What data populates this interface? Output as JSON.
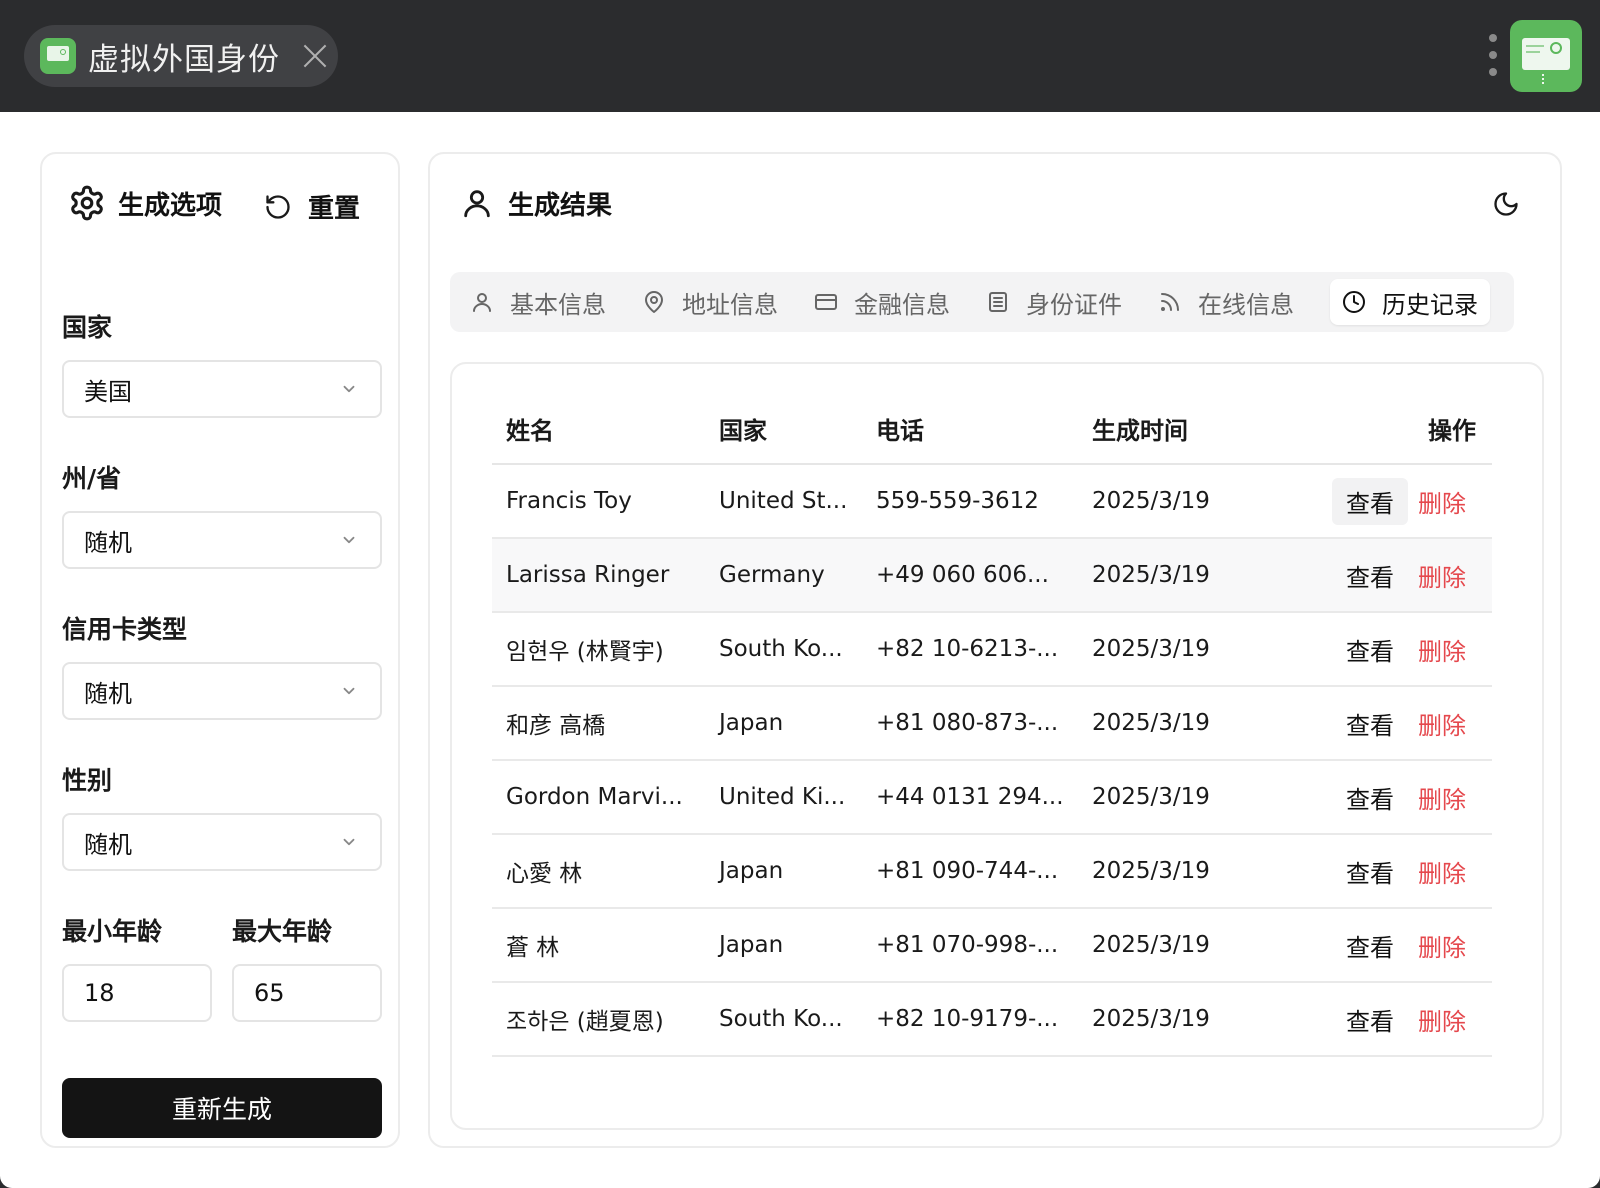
{
  "window": {
    "tab_title": "虚拟外国身份"
  },
  "left": {
    "title": "生成选项",
    "reset_label": "重置",
    "country_label": "国家",
    "country_value": "美国",
    "state_label": "州/省",
    "state_value": "随机",
    "card_label": "信用卡类型",
    "card_value": "随机",
    "gender_label": "性别",
    "gender_value": "随机",
    "min_age_label": "最小年龄",
    "max_age_label": "最大年龄",
    "min_age": "18",
    "max_age": "65",
    "regenerate_label": "重新生成"
  },
  "right": {
    "title": "生成结果",
    "tabs": [
      {
        "label": "基本信息",
        "icon": "user-icon"
      },
      {
        "label": "地址信息",
        "icon": "map-pin-icon"
      },
      {
        "label": "金融信息",
        "icon": "credit-card-icon"
      },
      {
        "label": "身份证件",
        "icon": "document-icon"
      },
      {
        "label": "在线信息",
        "icon": "rss-icon"
      },
      {
        "label": "历史记录",
        "icon": "clock-icon",
        "active": true
      }
    ],
    "table": {
      "headers": [
        "姓名",
        "国家",
        "电话",
        "生成时间",
        "操作"
      ],
      "view_label": "查看",
      "delete_label": "删除",
      "rows": [
        {
          "name": "Francis Toy",
          "country": "United St...",
          "phone": "559-559-3612",
          "time": "2025/3/19"
        },
        {
          "name": "Larissa Ringer",
          "country": "Germany",
          "phone": "+49 060 606...",
          "time": "2025/3/19"
        },
        {
          "name": "임현우 (林賢宇)",
          "country": "South Ko...",
          "phone": "+82 10-6213-...",
          "time": "2025/3/19"
        },
        {
          "name": "和彦 高橋",
          "country": "Japan",
          "phone": "+81 080-873-...",
          "time": "2025/3/19"
        },
        {
          "name": "Gordon Marvi...",
          "country": "United Ki...",
          "phone": "+44 0131 294...",
          "time": "2025/3/19"
        },
        {
          "name": "心愛 林",
          "country": "Japan",
          "phone": "+81 090-744-...",
          "time": "2025/3/19"
        },
        {
          "name": "蒼 林",
          "country": "Japan",
          "phone": "+81 070-998-...",
          "time": "2025/3/19"
        },
        {
          "name": "조하은 (趙夏恩)",
          "country": "South Ko...",
          "phone": "+82 10-9179-...",
          "time": "2025/3/19"
        }
      ]
    }
  },
  "colors": {
    "accent_green": "#5cb85c",
    "delete_red": "#e5484d",
    "primary_button": "#141414"
  }
}
